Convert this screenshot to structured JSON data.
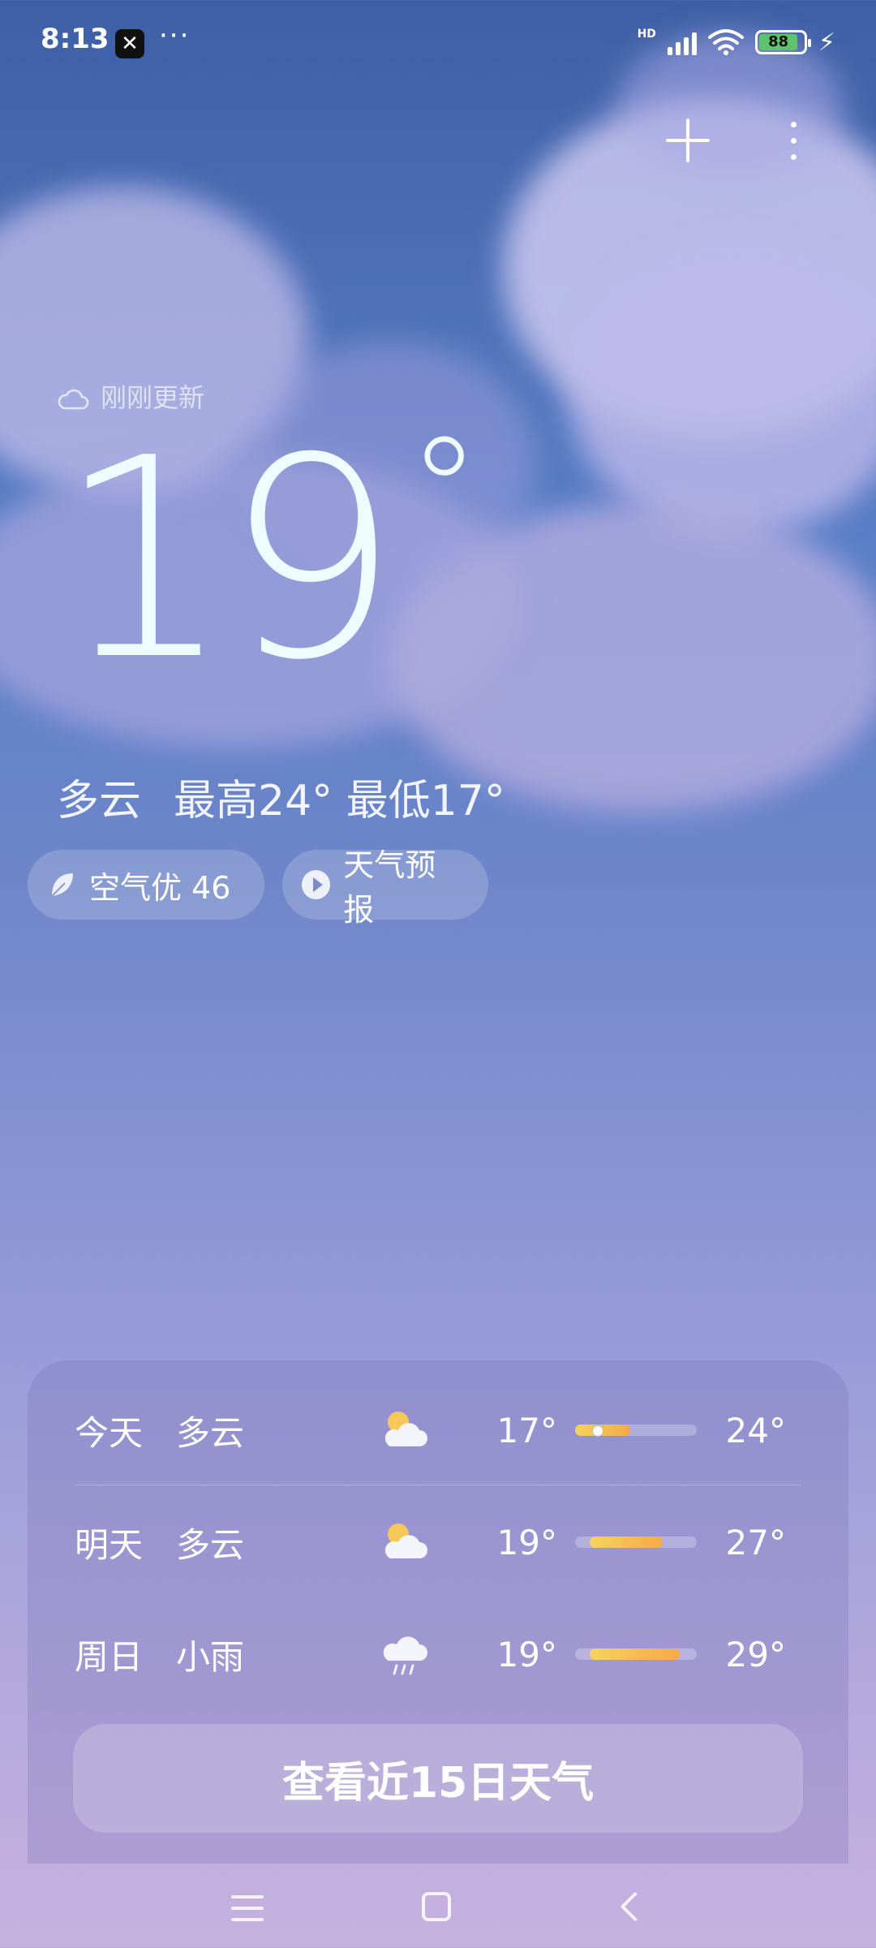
{
  "status_bar": {
    "time": "8:13",
    "more": "···",
    "hd": "HD",
    "battery": "88"
  },
  "location": {
    "name": "",
    "update_text": "刚刚更新"
  },
  "current": {
    "temperature": "19",
    "degree_symbol": "°",
    "condition": "多云",
    "high_low": "最高24° 最低17°"
  },
  "chips": {
    "air_quality": "空气优 46",
    "forecast_video": "天气预报"
  },
  "forecast": [
    {
      "day": "今天",
      "condition": "多云",
      "icon": "cloudy-sun-icon",
      "low": "17°",
      "high": "24°",
      "range_start": 0.0,
      "range_end": 0.45,
      "current_marker": 0.18
    },
    {
      "day": "明天",
      "condition": "多云",
      "icon": "cloudy-sun-icon",
      "low": "19°",
      "high": "27°",
      "range_start": 0.12,
      "range_end": 0.72
    },
    {
      "day": "周日",
      "condition": "小雨",
      "icon": "rain-cloud-icon",
      "low": "19°",
      "high": "29°",
      "range_start": 0.12,
      "range_end": 0.86
    }
  ],
  "cta": {
    "label": "查看近15日天气"
  },
  "colors": {
    "bar_start": "#f5d35b",
    "bar_end": "#f7a94a",
    "battery": "#5fc36b"
  }
}
